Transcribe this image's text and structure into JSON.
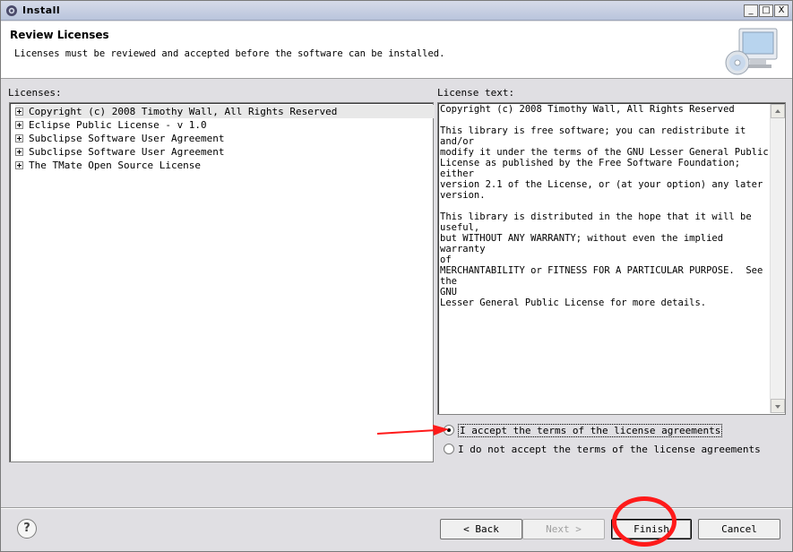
{
  "window": {
    "title": "Install",
    "minimize": "_",
    "maximize": "□",
    "close": "X"
  },
  "header": {
    "title": "Review Licenses",
    "description": "Licenses must be reviewed and accepted before the software can be installed."
  },
  "licenses": {
    "label": "Licenses:",
    "items": [
      "Copyright (c) 2008 Timothy Wall, All Rights Reserved",
      "Eclipse Public License - v 1.0",
      "Subclipse Software User Agreement",
      "Subclipse Software User Agreement",
      "The TMate Open Source License"
    ],
    "selected_index": 0
  },
  "license_text": {
    "label": "License text:",
    "content": "Copyright (c) 2008 Timothy Wall, All Rights Reserved\n\nThis library is free software; you can redistribute it and/or\nmodify it under the terms of the GNU Lesser General Public\nLicense as published by the Free Software Foundation; either\nversion 2.1 of the License, or (at your option) any later\nversion.\n\nThis library is distributed in the hope that it will be\nuseful,\nbut WITHOUT ANY WARRANTY; without even the implied warranty\nof\nMERCHANTABILITY or FITNESS FOR A PARTICULAR PURPOSE.  See the\nGNU\nLesser General Public License for more details."
  },
  "options": {
    "accept": "I accept the terms of the license agreements",
    "decline": "I do not accept the terms of the license agreements",
    "selected": "accept"
  },
  "buttons": {
    "help": "?",
    "back": "< Back",
    "next": "Next >",
    "finish": "Finish",
    "cancel": "Cancel"
  },
  "colors": {
    "annotation_red": "#ff1a1a"
  }
}
